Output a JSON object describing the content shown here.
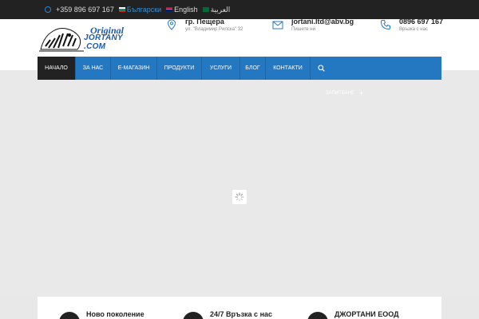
{
  "topbar": {
    "phone": "+359 896 697 167",
    "languages": [
      {
        "label": "Български",
        "flag": "bg",
        "active": true
      },
      {
        "label": "English",
        "flag": "en",
        "active": false
      },
      {
        "label": "العربية",
        "flag": "ar",
        "active": false
      }
    ]
  },
  "logo": {
    "script": "Original",
    "site": "JORTANY .COM"
  },
  "contacts": [
    {
      "title": "гр. Пещера",
      "sub": "ул. \"Владимир Рилска\" 32",
      "icon": "location-pin-icon"
    },
    {
      "title": "jortani.ltd@abv.bg",
      "sub": "Пишете ни",
      "icon": "envelope-icon"
    },
    {
      "title": "0896 697 167",
      "sub": "Връзка с нас",
      "icon": "phone-icon"
    }
  ],
  "nav": {
    "items": [
      "НАЧАЛО",
      "ЗА НАС",
      "Е-МАГАЗИН",
      "ПРОДУКТИ",
      "УСЛУГИ",
      "БЛОГ",
      "КОНТАКТИ"
    ],
    "active_index": 0
  },
  "hero": {
    "caption": "ЗАПИТВАНЕ"
  },
  "features": [
    {
      "label": "Ново поколение"
    },
    {
      "label": "24/7 Връзка с нас"
    },
    {
      "label": "ДЖОРТАНИ ЕООД"
    }
  ],
  "colors": {
    "accent": "#2478c2",
    "dark": "#222222"
  }
}
